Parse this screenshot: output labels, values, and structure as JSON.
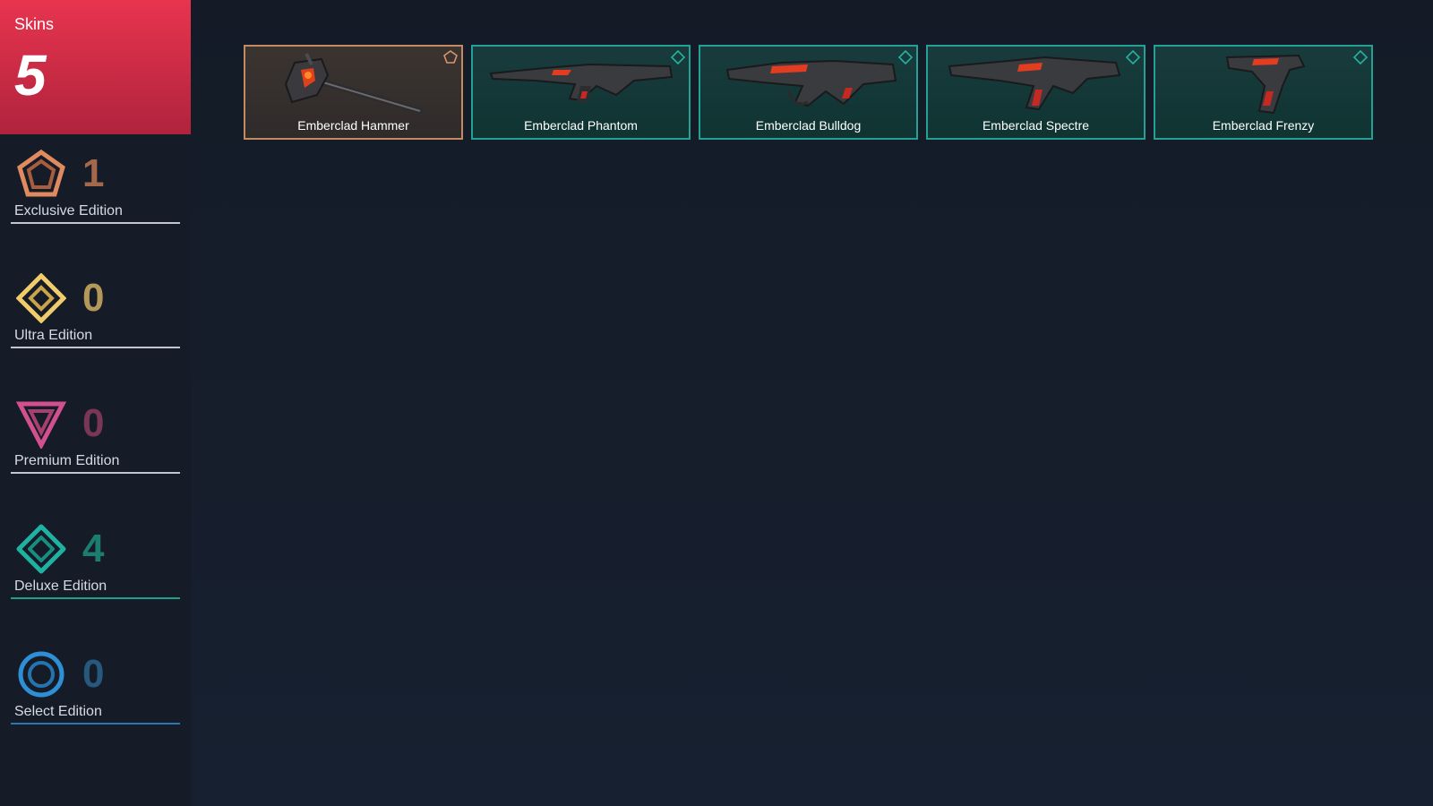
{
  "summary": {
    "label": "Skins",
    "count": "5"
  },
  "tiers": [
    {
      "name": "Exclusive Edition",
      "count": "1",
      "icon": "exclusive-edition-icon",
      "color": "#e08a5f",
      "count_color": "#a4694a",
      "line_color": "#c2c7cf"
    },
    {
      "name": "Ultra Edition",
      "count": "0",
      "icon": "ultra-edition-icon",
      "color": "#f0cc6a",
      "count_color": "#b3985a",
      "line_color": "#c2c7cf"
    },
    {
      "name": "Premium Edition",
      "count": "0",
      "icon": "premium-edition-icon",
      "color": "#d3508f",
      "count_color": "#7a3655",
      "line_color": "#c2c7cf"
    },
    {
      "name": "Deluxe Edition",
      "count": "4",
      "icon": "deluxe-edition-icon",
      "color": "#20b2a0",
      "count_color": "#1c7c70",
      "line_color": "#1f9e8a"
    },
    {
      "name": "Select Edition",
      "count": "0",
      "icon": "select-edition-icon",
      "color": "#2f8fd6",
      "count_color": "#27597d",
      "line_color": "#2d75b0"
    }
  ],
  "skins": [
    {
      "name": "Emberclad Hammer",
      "tier": "exclusive",
      "weapon_icon": "hammer-icon"
    },
    {
      "name": "Emberclad Phantom",
      "tier": "deluxe",
      "weapon_icon": "rifle-icon"
    },
    {
      "name": "Emberclad Bulldog",
      "tier": "deluxe",
      "weapon_icon": "rifle-icon"
    },
    {
      "name": "Emberclad Spectre",
      "tier": "deluxe",
      "weapon_icon": "smg-icon"
    },
    {
      "name": "Emberclad Frenzy",
      "tier": "deluxe",
      "weapon_icon": "pistol-icon"
    }
  ]
}
